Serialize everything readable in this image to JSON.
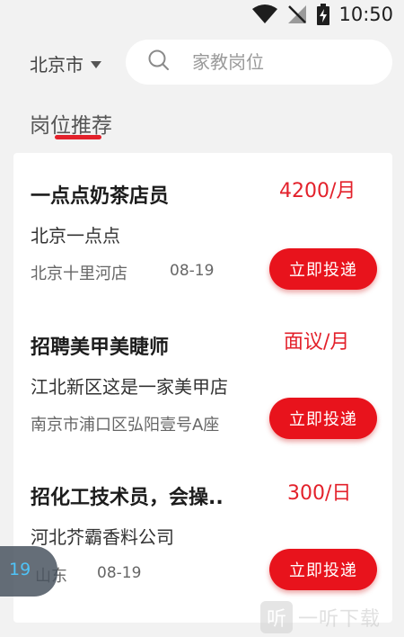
{
  "status_bar": {
    "time": "10:50"
  },
  "search_bar": {
    "city": "北京市",
    "placeholder": "家教岗位"
  },
  "section": {
    "title": "岗位推荐"
  },
  "jobs": [
    {
      "title": "一点点奶茶店员",
      "salary": "4200/月",
      "company": "北京一点点",
      "location": "北京十里河店",
      "date": "08-19",
      "button": "立即投递"
    },
    {
      "title": "招聘美甲美睫师",
      "salary": "面议/月",
      "company": "江北新区这是一家美甲店",
      "location": "南京市浦口区弘阳壹号A座",
      "date": "",
      "button": "立即投递"
    },
    {
      "title": "招化工技术员，会操..",
      "salary": "300/日",
      "company": "河北芥霸香料公司",
      "location": "山东",
      "date": "08-19",
      "button": "立即投递"
    }
  ],
  "floating_badge": {
    "text": "19"
  },
  "watermark": {
    "icon_glyph": "听",
    "text": "一听下载"
  },
  "colors": {
    "accent": "#e3212b",
    "background": "#f2f2f2"
  }
}
